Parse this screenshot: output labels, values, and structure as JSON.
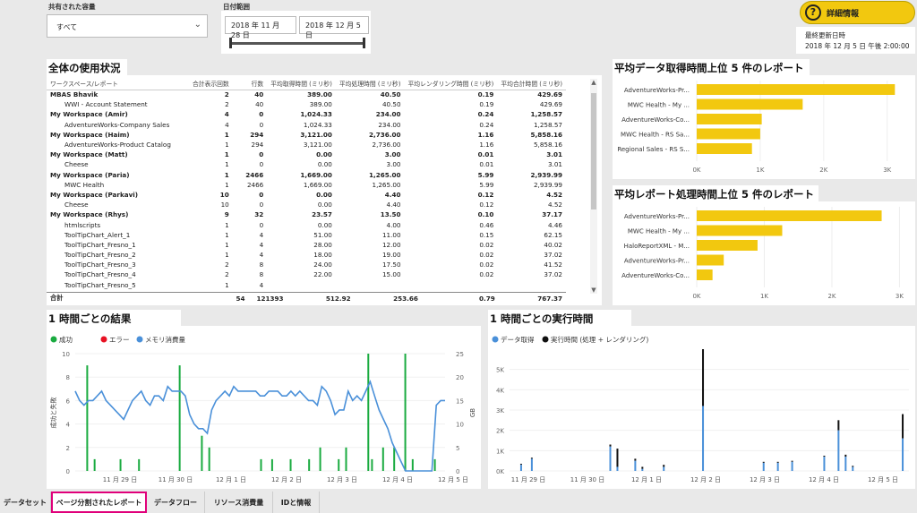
{
  "filters": {
    "capacity_label": "共有された容量",
    "capacity_value": "すべて",
    "date_label": "日付範囲",
    "date_start": "2018 年 11 月 28 日",
    "date_end": "2018 年 12 月 5 日"
  },
  "details_button": "詳細情報",
  "last_refresh_label": "最終更新日時",
  "last_refresh_value": "2018 年 12 月 5 日 午後 2:00:00",
  "usage": {
    "title": "全体の使用状況",
    "columns": [
      "ワークスペース/レポート",
      "合計表示回数",
      "行数",
      "平均取得時間 (ミリ秒)",
      "平均処理時間 (ミリ秒)",
      "平均レンダリング時間 (ミリ秒)",
      "平均合計時間 (ミリ秒)"
    ],
    "rows": [
      {
        "name": "MBAS Bhavik",
        "bold": true,
        "v": [
          "2",
          "40",
          "389.00",
          "40.50",
          "0.19",
          "429.69"
        ]
      },
      {
        "name": "WWI - Account Statement",
        "bold": false,
        "v": [
          "2",
          "40",
          "389.00",
          "40.50",
          "0.19",
          "429.69"
        ]
      },
      {
        "name": "My Workspace (Amir)",
        "bold": true,
        "v": [
          "4",
          "0",
          "1,024.33",
          "234.00",
          "0.24",
          "1,258.57"
        ]
      },
      {
        "name": "AdventureWorks-Company Sales",
        "bold": false,
        "v": [
          "4",
          "0",
          "1,024.33",
          "234.00",
          "0.24",
          "1,258.57"
        ]
      },
      {
        "name": "My Workspace (Haim)",
        "bold": true,
        "v": [
          "1",
          "294",
          "3,121.00",
          "2,736.00",
          "1.16",
          "5,858.16"
        ]
      },
      {
        "name": "AdventureWorks-Product Catalog",
        "bold": false,
        "v": [
          "1",
          "294",
          "3,121.00",
          "2,736.00",
          "1.16",
          "5,858.16"
        ]
      },
      {
        "name": "My Workspace (Matt)",
        "bold": true,
        "v": [
          "1",
          "0",
          "0.00",
          "3.00",
          "0.01",
          "3.01"
        ]
      },
      {
        "name": "Cheese",
        "bold": false,
        "v": [
          "1",
          "0",
          "0.00",
          "3.00",
          "0.01",
          "3.01"
        ]
      },
      {
        "name": "My Workspace (Paria)",
        "bold": true,
        "v": [
          "1",
          "2466",
          "1,669.00",
          "1,265.00",
          "5.99",
          "2,939.99"
        ]
      },
      {
        "name": "MWC Health",
        "bold": false,
        "v": [
          "1",
          "2466",
          "1,669.00",
          "1,265.00",
          "5.99",
          "2,939.99"
        ]
      },
      {
        "name": "My Workspace (Parkavi)",
        "bold": true,
        "v": [
          "10",
          "0",
          "0.00",
          "4.40",
          "0.12",
          "4.52"
        ]
      },
      {
        "name": "Cheese",
        "bold": false,
        "v": [
          "10",
          "0",
          "0.00",
          "4.40",
          "0.12",
          "4.52"
        ]
      },
      {
        "name": "My Workspace (Rhys)",
        "bold": true,
        "v": [
          "9",
          "32",
          "23.57",
          "13.50",
          "0.10",
          "37.17"
        ]
      },
      {
        "name": "htmlscripts",
        "bold": false,
        "v": [
          "1",
          "0",
          "0.00",
          "4.00",
          "0.46",
          "4.46"
        ]
      },
      {
        "name": "ToolTipChart_Alert_1",
        "bold": false,
        "v": [
          "1",
          "4",
          "51.00",
          "11.00",
          "0.15",
          "62.15"
        ]
      },
      {
        "name": "ToolTipChart_Fresno_1",
        "bold": false,
        "v": [
          "1",
          "4",
          "28.00",
          "12.00",
          "0.02",
          "40.02"
        ]
      },
      {
        "name": "ToolTipChart_Fresno_2",
        "bold": false,
        "v": [
          "1",
          "4",
          "18.00",
          "19.00",
          "0.02",
          "37.02"
        ]
      },
      {
        "name": "ToolTipChart_Fresno_3",
        "bold": false,
        "v": [
          "2",
          "8",
          "24.00",
          "17.50",
          "0.02",
          "41.52"
        ]
      },
      {
        "name": "ToolTipChart_Fresno_4",
        "bold": false,
        "v": [
          "2",
          "8",
          "22.00",
          "15.00",
          "0.02",
          "37.02"
        ]
      },
      {
        "name": "ToolTipChart_Fresno_5",
        "bold": false,
        "v": [
          "1",
          "4",
          "",
          "",
          "",
          ""
        ]
      }
    ],
    "total": {
      "name": "合計",
      "v": [
        "54",
        "121393",
        "512.92",
        "253.66",
        "0.79",
        "767.37"
      ]
    }
  },
  "chart_data": [
    {
      "type": "bar",
      "title": "平均データ取得時間上位 5 件のレポート",
      "categories": [
        "AdventureWorks-Pr...",
        "MWC Health - My ...",
        "AdventureWorks-Co...",
        "MWC Health - RS Sa...",
        "Regional Sales - RS S..."
      ],
      "values": [
        3121,
        1669,
        1024,
        1000,
        870
      ],
      "xticks": [
        "0K",
        "1K",
        "2K",
        "3K"
      ],
      "xlim": [
        0,
        3300
      ],
      "color": "#f2c80f"
    },
    {
      "type": "bar",
      "title": "平均レポート処理時間上位 5 件のレポート",
      "categories": [
        "AdventureWorks-Pr...",
        "MWC Health - My ...",
        "HaloReportXML - M...",
        "AdventureWorks-Pr...",
        "AdventureWorks-Co..."
      ],
      "values": [
        2736,
        1265,
        900,
        400,
        234
      ],
      "xticks": [
        "0K",
        "1K",
        "2K",
        "3K"
      ],
      "xlim": [
        0,
        3100
      ],
      "color": "#f2c80f"
    },
    {
      "type": "line",
      "title": "1 時間ごとの結果",
      "legend": [
        "成功",
        "エラー",
        "メモリ消費量"
      ],
      "ylabel_left": "成功と失敗",
      "ylabel_right": "GB",
      "yticks_left": [
        "0",
        "2",
        "4",
        "6",
        "8",
        "10"
      ],
      "yticks_right": [
        "0",
        "5",
        "10",
        "15",
        "20",
        "25"
      ],
      "xticks": [
        "11 月 29 日",
        "11 月 30 日",
        "12 月 1 日",
        "12 月 2 日",
        "12 月 3 日",
        "12 月 4 日",
        "12 月 5 日"
      ],
      "memory": [
        17,
        15,
        14,
        15,
        15,
        16,
        17,
        15,
        14,
        13,
        12,
        11,
        13,
        15,
        16,
        17,
        15,
        14,
        16,
        16,
        15,
        18,
        17,
        17,
        17,
        16,
        12,
        10,
        9,
        9,
        8,
        13,
        15,
        16,
        17,
        16,
        18,
        17,
        17,
        17,
        17,
        17,
        16,
        16,
        17,
        17,
        17,
        16,
        16,
        17,
        16,
        17,
        16,
        15,
        15,
        14,
        18,
        17,
        15,
        12,
        13,
        13,
        17,
        15,
        16,
        15,
        17,
        19,
        16,
        13,
        11,
        9,
        6,
        4,
        2,
        0,
        0,
        0,
        0,
        0,
        0,
        0,
        14,
        15,
        15
      ],
      "success_bars": [
        [
          3,
          9
        ],
        [
          5,
          1
        ],
        [
          12,
          1
        ],
        [
          17,
          1
        ],
        [
          28,
          9
        ],
        [
          34,
          3
        ],
        [
          36,
          2
        ],
        [
          50,
          1
        ],
        [
          53,
          1
        ],
        [
          58,
          1
        ],
        [
          63,
          1
        ],
        [
          66,
          2
        ],
        [
          71,
          1
        ],
        [
          73,
          2
        ],
        [
          79,
          10
        ],
        [
          80,
          1
        ],
        [
          83,
          2
        ],
        [
          86,
          2
        ],
        [
          89,
          10
        ],
        [
          91,
          1
        ],
        [
          97,
          1
        ]
      ],
      "success_max": 10,
      "mem_max": 25
    },
    {
      "type": "bar",
      "title": "1 時間ごとの実行時間",
      "legend": [
        "データ取得",
        "実行時間 (処理 + レンダリング)"
      ],
      "yticks": [
        "0K",
        "1K",
        "2K",
        "3K",
        "4K",
        "5K"
      ],
      "xticks": [
        "11 月 29 日",
        "11 月 30 日",
        "12 月 1 日",
        "12 月 2 日",
        "12 月 3 日",
        "12 月 4 日",
        "12 月 5 日"
      ],
      "bars": [
        [
          3,
          300,
          350
        ],
        [
          6,
          600,
          650
        ],
        [
          28,
          1200,
          1300
        ],
        [
          30,
          200,
          1100
        ],
        [
          35,
          500,
          600
        ],
        [
          37,
          100,
          200
        ],
        [
          43,
          200,
          300
        ],
        [
          54,
          3200,
          6000
        ],
        [
          71,
          400,
          450
        ],
        [
          75,
          400,
          450
        ],
        [
          79,
          450,
          500
        ],
        [
          88,
          700,
          750
        ],
        [
          92,
          2000,
          2500
        ],
        [
          94,
          700,
          800
        ],
        [
          96,
          200,
          250
        ],
        [
          110,
          1600,
          2800
        ]
      ],
      "ymax": 6000,
      "xcount": 112
    }
  ],
  "tabs": [
    "データセット",
    "ページ分割されたレポート",
    "データフロー",
    "リソース消費量",
    "IDと情報"
  ],
  "active_tab": 1
}
